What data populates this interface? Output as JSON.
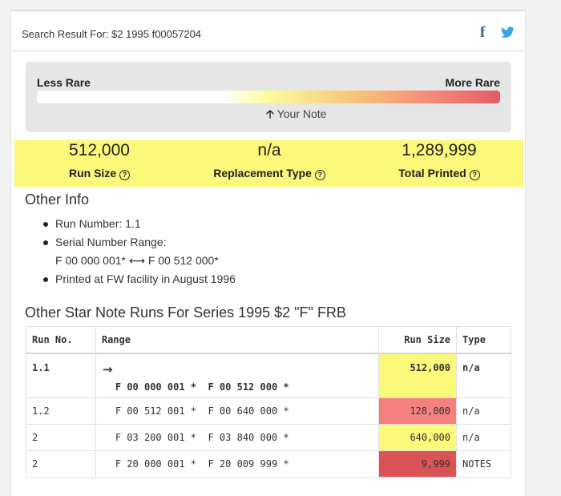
{
  "header": {
    "search_label": "Search Result For: $2 1995 f00057204",
    "share_icons": [
      "facebook-icon",
      "twitter-icon"
    ]
  },
  "rarity": {
    "less_label": "Less Rare",
    "more_label": "More Rare",
    "your_note_label": "Your Note",
    "arrow_icon": "up-arrow-icon",
    "note_position_fraction": 0.5
  },
  "stats": [
    {
      "value": "512,000",
      "label": "Run Size"
    },
    {
      "value": "n/a",
      "label": "Replacement Type"
    },
    {
      "value": "1,289,999",
      "label": "Total Printed"
    }
  ],
  "other_info": {
    "title": "Other Info",
    "run_number": "Run Number: 1.1",
    "serial_range_label": "Serial Number Range:",
    "serial_range_start": "F 00 000 001*",
    "serial_range_end": "F 00 512 000*",
    "printed_at": "Printed at FW facility in August 1996"
  },
  "runs": {
    "title": "Other Star Note Runs For Series 1995 $2 \"F\" FRB",
    "columns": [
      "Run No.",
      "Range",
      "Run Size",
      "Type"
    ],
    "rows": [
      {
        "run": "1.1",
        "range_start": "F 00 000 001 *",
        "range_end": "F 00 512 000 *",
        "size": "512,000",
        "type": "n/a",
        "color": "#faf97a"
      },
      {
        "run": "1.2",
        "range_start": "F 00 512 001 *",
        "range_end": "F 00 640 000 *",
        "size": "128,000",
        "type": "n/a",
        "color": "#f58080"
      },
      {
        "run": "2",
        "range_start": "F 03 200 001 *",
        "range_end": "F 03 840 000 *",
        "size": "640,000",
        "type": "n/a",
        "color": "#faf97a"
      },
      {
        "run": "2",
        "range_start": "F 20 000 001 *",
        "range_end": "F 20 009 999 *",
        "size": "9,999",
        "type": "NOTES",
        "color": "#db5455"
      }
    ]
  }
}
